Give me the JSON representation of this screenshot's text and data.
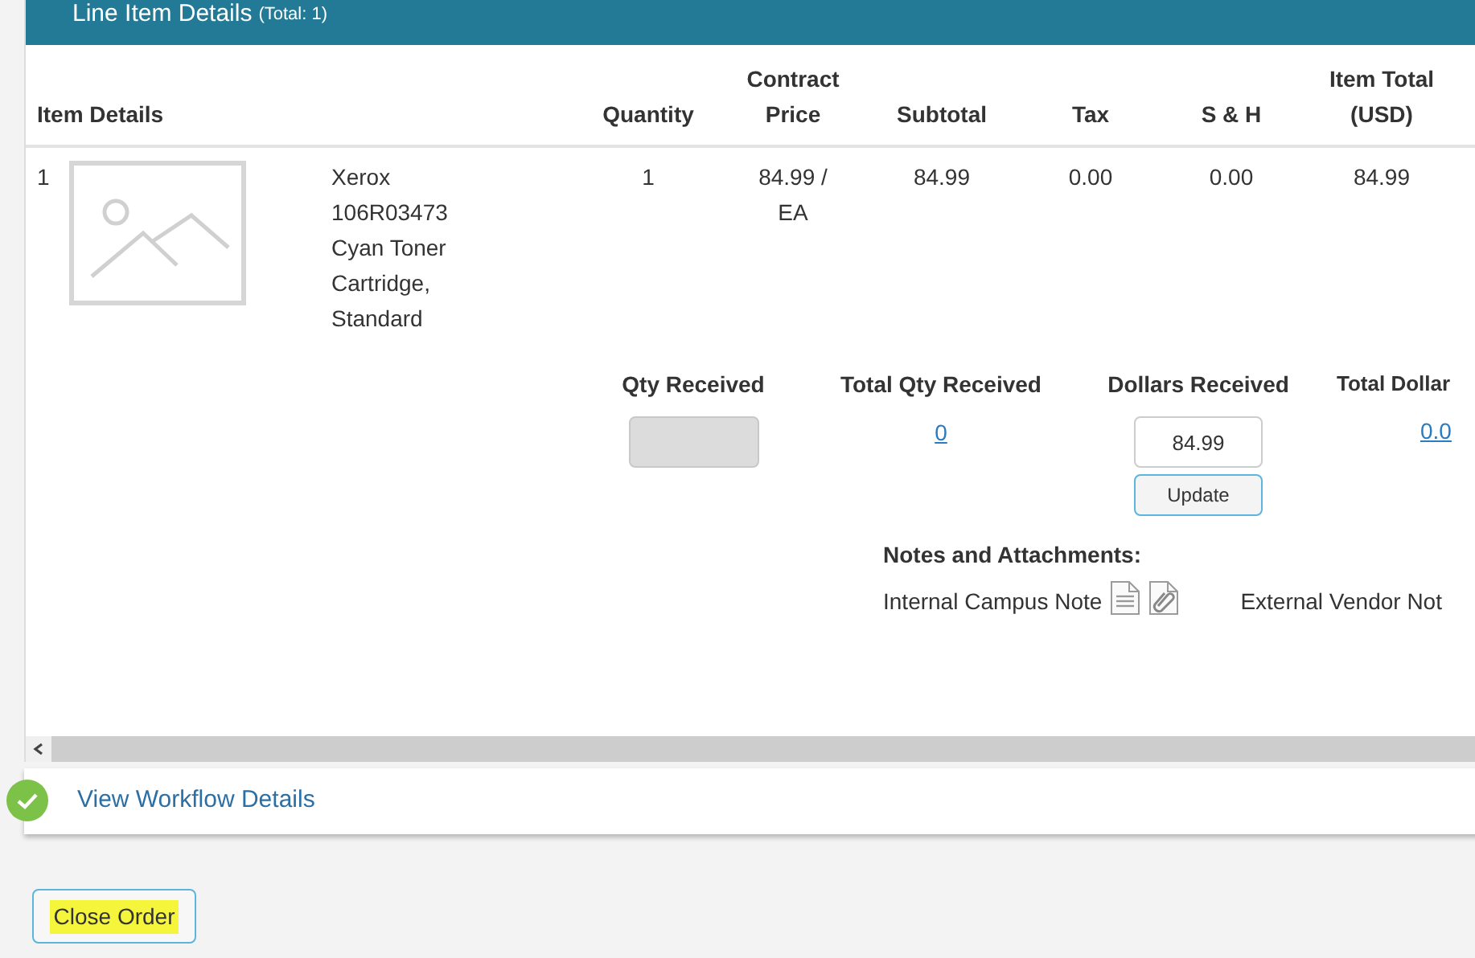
{
  "section": {
    "title": "Line Item Details",
    "total": "(Total: 1)"
  },
  "columns": [
    {
      "label": "Item Details",
      "kind": "left"
    },
    {
      "label": "Quantity",
      "kind": "center"
    },
    {
      "label": "Contract Price",
      "kind": "center"
    },
    {
      "label": "Subtotal",
      "kind": "center"
    },
    {
      "label": "Tax",
      "kind": "center"
    },
    {
      "label": "S & H",
      "kind": "center"
    },
    {
      "label": "Item Total (USD)",
      "kind": "center"
    }
  ],
  "item": {
    "number": "1",
    "image": {
      "kind": "placeholder"
    },
    "description": "Xerox 106R03473 Cyan Toner Cartridge, Standard",
    "quantity": "1",
    "contract_price": "84.99 / EA",
    "subtotal": "84.99",
    "tax": "0.00",
    "shipping": "0.00",
    "item_total": "84.99"
  },
  "receiving": {
    "qty_received": {
      "label": "Qty Received",
      "disabled": true
    },
    "total_qty_received": {
      "label": "Total Qty Received",
      "value": "0"
    },
    "dollars_received": {
      "label": "Dollars Received",
      "value": "84.99",
      "button": "Update"
    },
    "total_dollars": {
      "label": "Total Dollar",
      "value": "0.0"
    }
  },
  "notes": {
    "title": "Notes and Attachments:",
    "internal": "Internal Campus Note",
    "external": "External Vendor Not"
  },
  "workflow": {
    "link": "View Workflow Details",
    "complete": true
  },
  "close_button": {
    "label": "Close Order",
    "highlighted": true
  }
}
